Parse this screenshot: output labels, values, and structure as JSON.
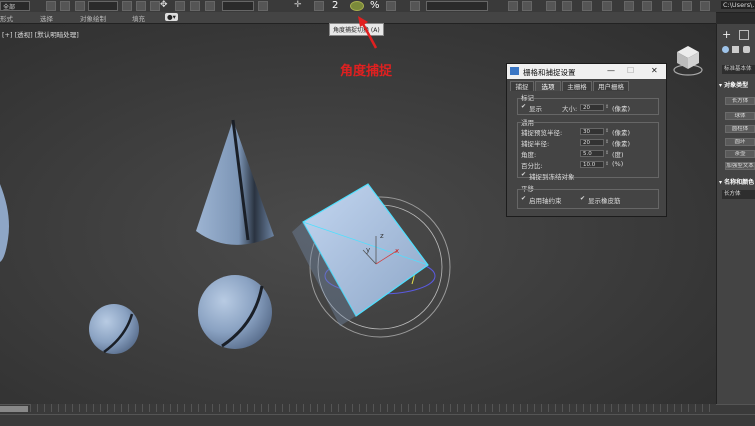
{
  "toolbar": {
    "dropdown_value": "全部",
    "snap_label": "2",
    "percent_label": "%",
    "file_path": "C:\\Users\\..."
  },
  "sec_toolbar": {
    "items": [
      "形式",
      "选择",
      "对象绘制",
      "填充"
    ]
  },
  "tooltip": "角度捕捉切换 (A)",
  "viewport": {
    "label": "[+] [透视] [默认明暗处理]"
  },
  "annotation": "角度捕捉",
  "dialog": {
    "title": "栅格和捕捉设置",
    "tabs": [
      "捕捉",
      "选项",
      "主栅格",
      "用户栅格"
    ],
    "marker_group": "标记",
    "show_label": "显示",
    "size_label": "大小:",
    "size_value": "20",
    "pixel_unit": "(像素)",
    "general_group": "通用",
    "preview_radius_label": "捕捉预览半径:",
    "preview_radius_value": "30",
    "snap_radius_label": "捕捉半径:",
    "snap_radius_value": "20",
    "angle_label": "角度:",
    "angle_value": "5.0",
    "degree_unit": "(度)",
    "percent_label": "百分比:",
    "percent_value": "10.0",
    "percent_unit": "(%)",
    "snap_frozen_label": "捕捉到冻结对象",
    "translate_group": "平移",
    "use_axis_label": "启用轴约束",
    "show_rubber_label": "显示橡皮筋",
    "check_mark": "✔",
    "minimize": "—",
    "maximize": "☐",
    "close": "✕"
  },
  "right_panel": {
    "plus": "+",
    "dropdown": "标准基本体",
    "section1": "对象类型",
    "buttons": [
      "长方体",
      "球体",
      "圆柱体",
      "圆环",
      "茶壶",
      "加强型文本"
    ],
    "section2": "名称和颜色",
    "name_value": "长方体"
  },
  "colors": {
    "annotation": "#e02020",
    "selection": "#4de0ff",
    "object": "#8fa9c9"
  }
}
